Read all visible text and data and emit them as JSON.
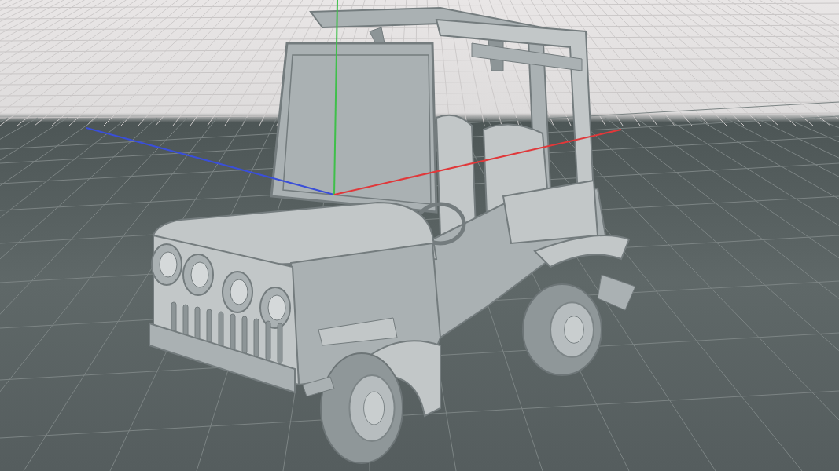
{
  "viewport": {
    "axes": [
      {
        "kind": "horizontal-left",
        "color": "#3a4fd8"
      },
      {
        "kind": "vertical",
        "color": "#3fbf4a"
      },
      {
        "kind": "horizontal-right",
        "color": "#e0383a"
      }
    ]
  }
}
